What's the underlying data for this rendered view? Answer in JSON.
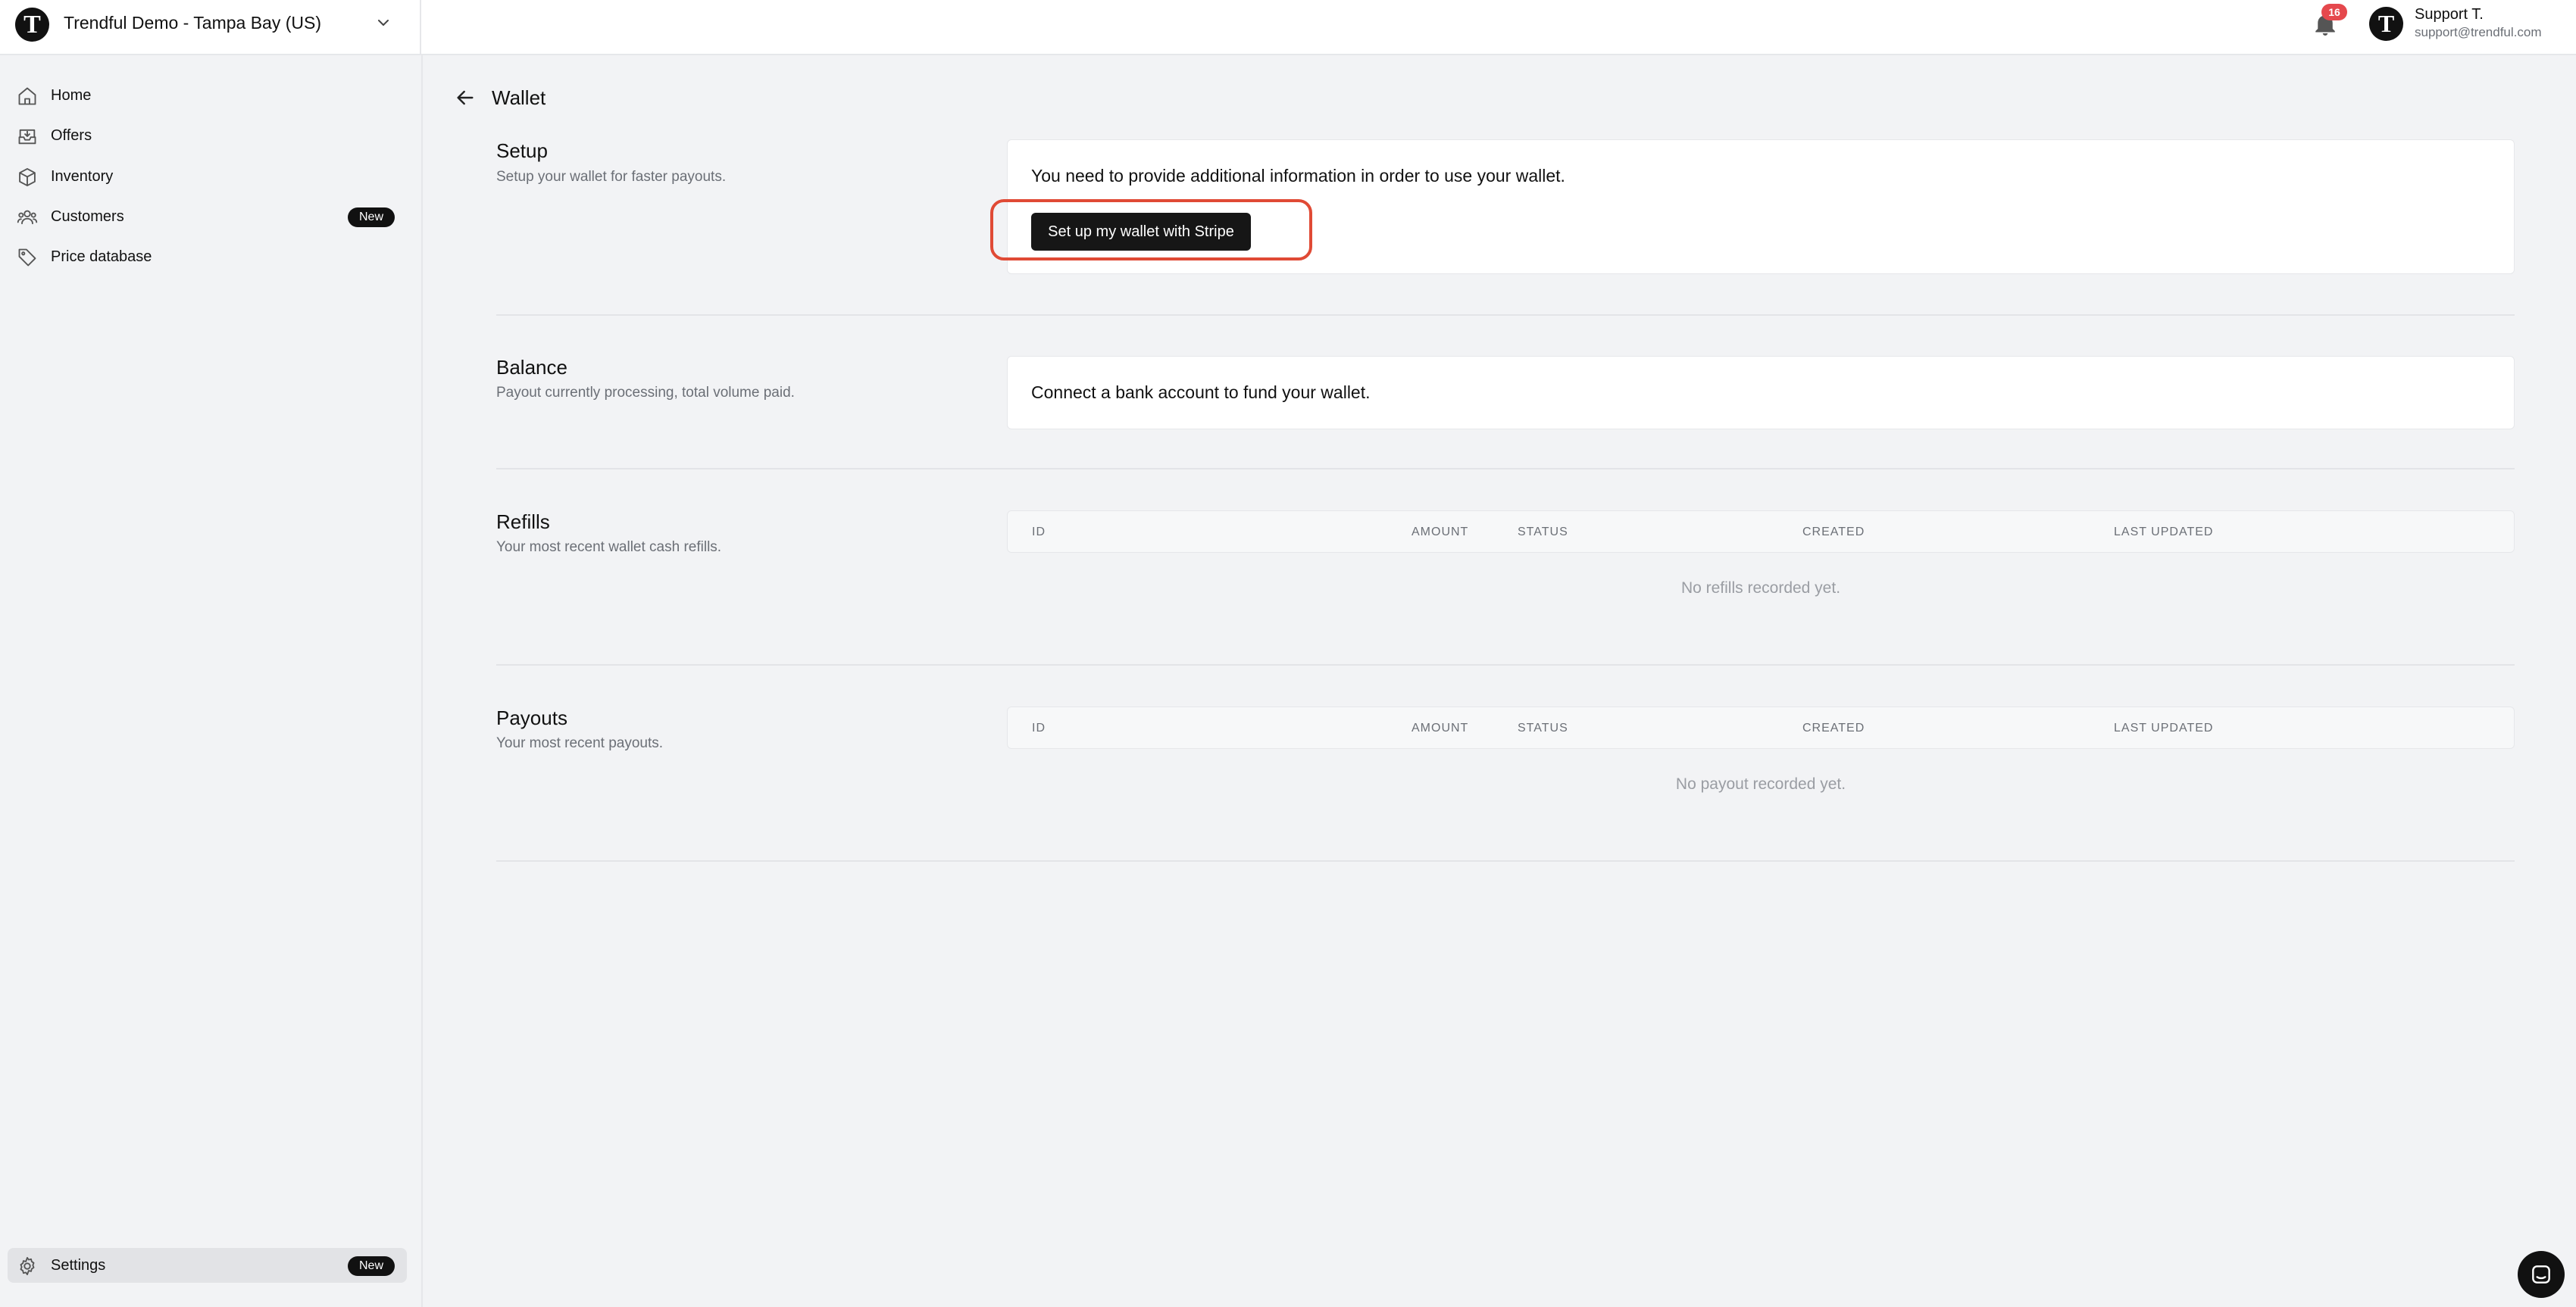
{
  "store": {
    "logo_letter": "T",
    "name": "Trendful Demo - Tampa Bay (US)"
  },
  "header": {
    "notification_count": "16",
    "user_avatar_letter": "T",
    "user_name": "Support T.",
    "user_email": "support@trendful.com"
  },
  "sidebar": {
    "items": [
      {
        "label": "Home",
        "icon": "home-icon"
      },
      {
        "label": "Offers",
        "icon": "inbox-icon"
      },
      {
        "label": "Inventory",
        "icon": "box-icon"
      },
      {
        "label": "Customers",
        "icon": "users-icon",
        "badge": "New"
      },
      {
        "label": "Price database",
        "icon": "tag-icon"
      }
    ],
    "settings": {
      "label": "Settings",
      "icon": "gear-icon",
      "badge": "New"
    }
  },
  "page": {
    "title": "Wallet"
  },
  "setup": {
    "title": "Setup",
    "description": "Setup your wallet for faster payouts.",
    "message": "You need to provide additional information in order to use your wallet.",
    "button_label": "Set up my wallet with Stripe"
  },
  "balance": {
    "title": "Balance",
    "description": "Payout currently processing, total volume paid.",
    "message": "Connect a bank account to fund your wallet."
  },
  "refills": {
    "title": "Refills",
    "description": "Your most recent wallet cash refills.",
    "columns": [
      "ID",
      "AMOUNT",
      "STATUS",
      "CREATED",
      "LAST UPDATED"
    ],
    "empty_message": "No refills recorded yet."
  },
  "payouts": {
    "title": "Payouts",
    "description": "Your most recent payouts.",
    "columns": [
      "ID",
      "AMOUNT",
      "STATUS",
      "CREATED",
      "LAST UPDATED"
    ],
    "empty_message": "No payout recorded yet."
  },
  "colors": {
    "accent_dark": "#161616",
    "highlight_ring": "#e04a35",
    "notification_badge": "#e5484d",
    "page_background": "#f2f3f5"
  }
}
